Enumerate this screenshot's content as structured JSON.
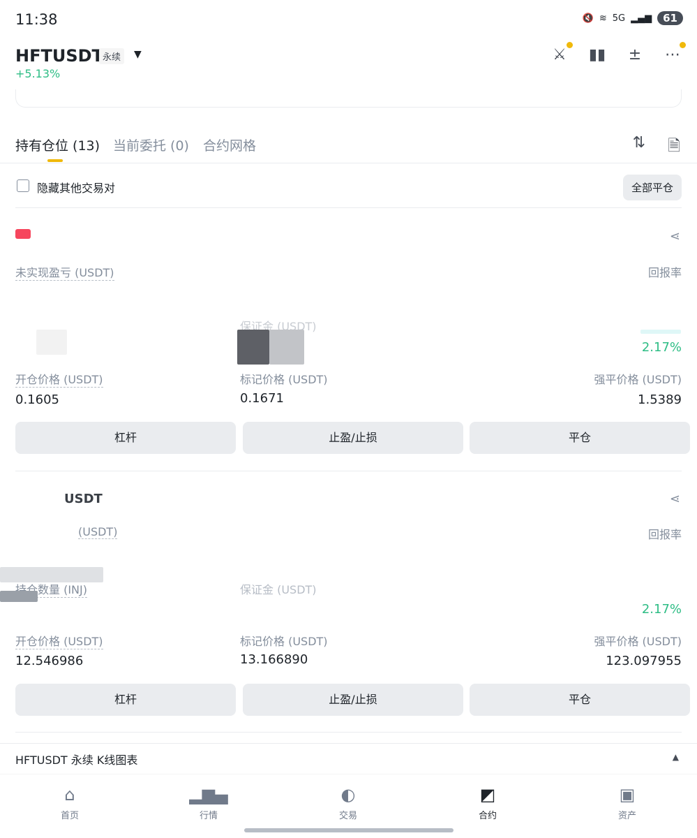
{
  "status_bar": {
    "time": "11:38",
    "network": "5G",
    "battery": "61"
  },
  "header": {
    "symbol": "HFTUSDT",
    "contract_type": "永续",
    "change": "+5.13%",
    "actions": [
      "crossed-swords-icon",
      "candlestick-icon",
      "plus-minus-icon",
      "more-icon"
    ]
  },
  "tabs": {
    "positions": "持有仓位 (13)",
    "open_orders": "当前委托 (0)",
    "grid": "合约网格"
  },
  "filter": {
    "hide_other_pairs": "隐藏其他交易对",
    "close_all": "全部平仓"
  },
  "positions": [
    {
      "symbol": "",
      "unrealized_pnl_label": "未实现盈亏 (USDT)",
      "roe_label": "回报率",
      "margin_label": "保证金 (USDT)",
      "roe_value": "2.17%",
      "entry_price_label": "开仓价格 (USDT)",
      "entry_price": "0.1605",
      "mark_price_label": "标记价格 (USDT)",
      "mark_price": "0.1671",
      "liq_price_label": "强平价格 (USDT)",
      "liq_price": "1.5389",
      "buttons": {
        "leverage": "杠杆",
        "tpsl": "止盈/止损",
        "close": "平仓"
      }
    },
    {
      "symbol": "USDT",
      "unrealized_pnl_label": "(USDT)",
      "roe_label": "回报率",
      "size_label": "持仓数量 (INJ)",
      "margin_label": "保证金 (USDT)",
      "roe_value": "2.17%",
      "entry_price_label": "开仓价格 (USDT)",
      "entry_price": "12.546986",
      "mark_price_label": "标记价格 (USDT)",
      "mark_price": "13.166890",
      "liq_price_label": "强平价格 (USDT)",
      "liq_price": "123.097955",
      "buttons": {
        "leverage": "杠杆",
        "tpsl": "止盈/止损",
        "close": "平仓"
      }
    }
  ],
  "kline_bar": {
    "label": "HFTUSDT 永续 K线图表"
  },
  "bottom_nav": [
    {
      "label": "首页",
      "icon": "home-icon"
    },
    {
      "label": "行情",
      "icon": "markets-icon"
    },
    {
      "label": "交易",
      "icon": "trade-icon"
    },
    {
      "label": "合约",
      "icon": "futures-icon",
      "active": true
    },
    {
      "label": "资产",
      "icon": "wallet-icon"
    }
  ],
  "colors": {
    "accent": "#f0b90b",
    "up": "#2ebd85",
    "down": "#f6465d"
  }
}
